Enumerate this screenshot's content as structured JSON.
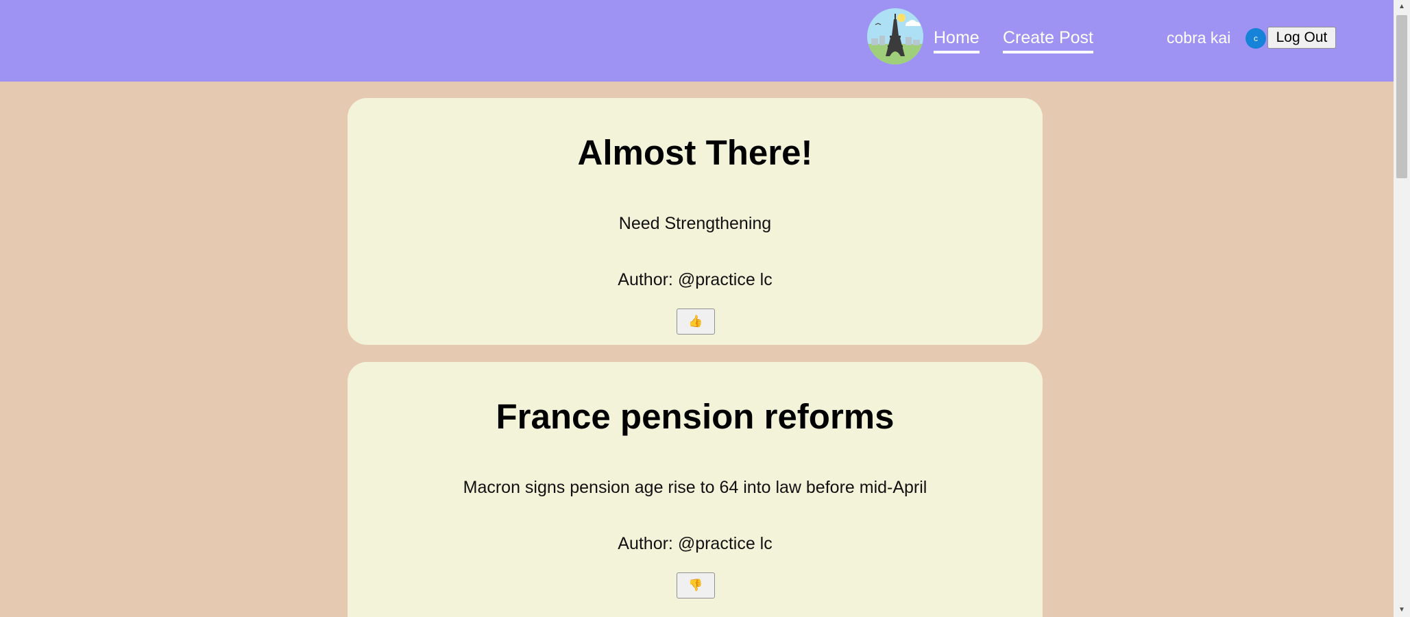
{
  "header": {
    "nav": {
      "home_label": "Home",
      "create_post_label": "Create Post"
    },
    "user": {
      "username": "cobra kai",
      "avatar_initial": "c",
      "logout_label": "Log Out"
    },
    "colors": {
      "navbar": "#9e92f2",
      "page_background": "#e5c9b0",
      "card_background": "#f3f3da",
      "avatar": "#1683d8"
    }
  },
  "posts": [
    {
      "title": "Almost There!",
      "body": "Need Strengthening",
      "author": "Author: @practice lc",
      "reaction_icon": "thumbs-up-icon",
      "reaction_glyph": "👍"
    },
    {
      "title": "France pension reforms",
      "body": "Macron signs pension age rise to 64 into law before mid-April",
      "author": "Author: @practice lc",
      "reaction_icon": "thumbs-down-icon",
      "reaction_glyph": "👎"
    }
  ]
}
